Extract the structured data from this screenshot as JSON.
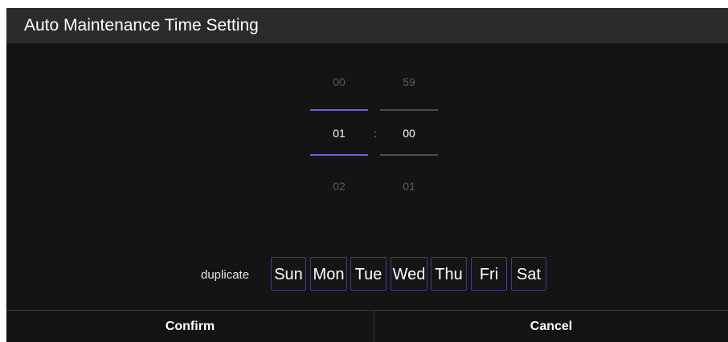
{
  "dialog": {
    "title": "Auto Maintenance Time Setting"
  },
  "time_picker": {
    "hour": {
      "prev": "00",
      "selected": "01",
      "next": "02"
    },
    "separator": ":",
    "minute": {
      "prev": "59",
      "selected": "00",
      "next": "01"
    },
    "accent_color": "#6b5fd8"
  },
  "repeat": {
    "label": "duplicate",
    "days": [
      "Sun",
      "Mon",
      "Tue",
      "Wed",
      "Thu",
      "Fri",
      "Sat"
    ]
  },
  "footer": {
    "confirm_label": "Confirm",
    "cancel_label": "Cancel"
  }
}
